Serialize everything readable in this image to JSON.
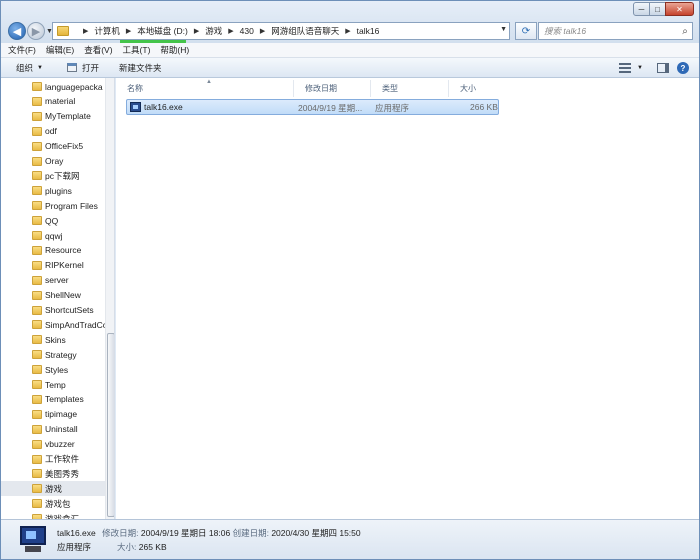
{
  "window": {
    "controls": {
      "minimize": "─",
      "maximize": "□",
      "close": "✕"
    }
  },
  "address": {
    "crumbs": [
      "计算机",
      "本地磁盘 (D:)",
      "游戏",
      "430",
      "网游组队语音聊天",
      "talk16"
    ]
  },
  "search": {
    "placeholder": "搜索 talk16"
  },
  "menubar": [
    "文件(F)",
    "编辑(E)",
    "查看(V)",
    "工具(T)",
    "帮助(H)"
  ],
  "toolbar": {
    "organize": "组织",
    "open": "打开",
    "new_folder": "新建文件夹"
  },
  "nav": {
    "items": [
      "languagepacka",
      "material",
      "MyTemplate",
      "odf",
      "OfficeFix5",
      "Oray",
      "pc下载网",
      "plugins",
      "Program Files",
      "QQ",
      "qqwj",
      "Resource",
      "RIPKernel",
      "server",
      "ShellNew",
      "ShortcutSets",
      "SimpAndTradCo",
      "Skins",
      "Strategy",
      "Styles",
      "Temp",
      "Templates",
      "tipimage",
      "Uninstall",
      "vbuzzer",
      "工作软件",
      "美图秀秀",
      "游戏",
      "游戏包",
      "游戏盒汇"
    ],
    "selected_index": 27
  },
  "columns": {
    "name": "名称",
    "date": "修改日期",
    "type": "类型",
    "size": "大小"
  },
  "files": [
    {
      "name": "talk16.exe",
      "date": "2004/9/19 星期...",
      "type": "应用程序",
      "size": "266 KB",
      "icon": "exe-icon"
    }
  ],
  "details": {
    "filename": "talk16.exe",
    "modified_label": "修改日期:",
    "modified": "2004/9/19 星期日 18:06",
    "created_label": "创建日期:",
    "created": "2020/4/30 星期四 15:50",
    "type": "应用程序",
    "size_label": "大小:",
    "size": "265 KB"
  },
  "colors": {
    "selection": "#cce4fb",
    "accent": "#2e69b6",
    "progress": "#44c44a"
  }
}
